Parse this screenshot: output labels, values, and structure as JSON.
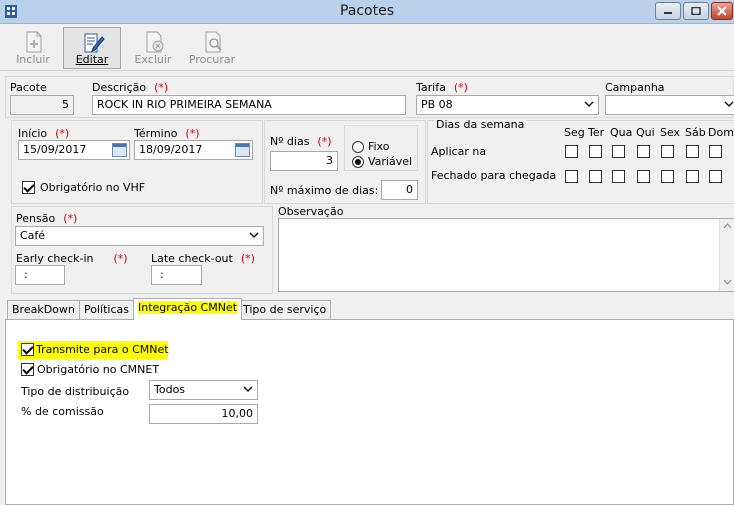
{
  "window": {
    "title": "Pacotes"
  },
  "toolbar": {
    "incluir": "Incluir",
    "editar": "Editar",
    "excluir": "Excluir",
    "procurar": "Procurar"
  },
  "required_mark": "(*)",
  "form": {
    "pacote_label": "Pacote",
    "pacote_value": "5",
    "descricao_label": "Descrição",
    "descricao_value": "ROCK IN RIO PRIMEIRA SEMANA",
    "tarifa_label": "Tarifa",
    "tarifa_value": "PB 08",
    "campanha_label": "Campanha",
    "campanha_value": "",
    "inicio_label": "Início",
    "inicio_value": "15/09/2017",
    "termino_label": "Término",
    "termino_value": "18/09/2017",
    "obrig_vhf_label": "Obrigatório no VHF",
    "obrig_vhf_checked": true,
    "ndias_label": "Nº dias",
    "ndias_value": "3",
    "fixo_label": "Fixo",
    "variavel_label": "Variável",
    "selected_mode": "Variável",
    "max_dias_label": "Nº máximo de dias:",
    "max_dias_value": "0",
    "pensao_label": "Pensão",
    "pensao_value": "Café",
    "early_label": "Early check-in",
    "early_value": ":",
    "late_label": "Late check-out",
    "late_value": ":",
    "observacao_label": "Observação"
  },
  "dias_semana": {
    "title": "Dias da semana",
    "days": [
      "Seg",
      "Ter",
      "Qua",
      "Qui",
      "Sex",
      "Sáb",
      "Dom"
    ],
    "row1_label": "Aplicar na",
    "row2_label": "Fechado para chegada"
  },
  "tabs": [
    {
      "label": "BreakDown"
    },
    {
      "label": "Políticas"
    },
    {
      "label": "Integração CMNet"
    },
    {
      "label": "Tipo de serviço"
    }
  ],
  "active_tab": "Integração CMNet",
  "cmnet": {
    "transmite_label": "Transmite para o CMNet",
    "transmite_checked": true,
    "obrigatorio_label": "Obrigatório no CMNET",
    "obrigatorio_checked": true,
    "tipo_label": "Tipo de distribuição",
    "tipo_value": "Todos",
    "comissao_label": "% de comissão",
    "comissao_value": "10,00",
    "highlight_color": "#ffff00"
  }
}
